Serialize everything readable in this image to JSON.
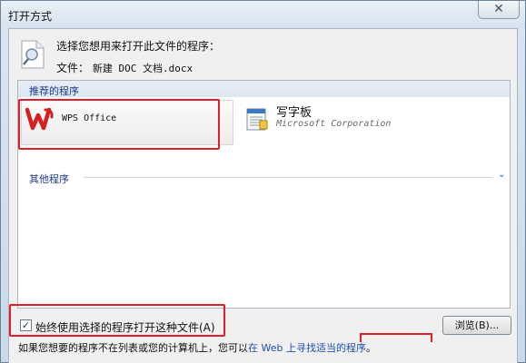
{
  "window": {
    "title": "打开方式",
    "close_glyph": "✕"
  },
  "header": {
    "prompt": "选择您想用来打开此文件的程序：",
    "file_label": "文件：",
    "file_name": "新建 DOC 文档.docx"
  },
  "list": {
    "recommended_label": "推荐的程序",
    "programs": [
      {
        "name": "WPS Office",
        "company": "",
        "icon": "wps-logo-icon"
      },
      {
        "name": "写字板",
        "company": "Microsoft Corporation",
        "icon": "wordpad-icon"
      }
    ],
    "other_label": "其他程序",
    "expand_glyph": "⌄"
  },
  "options": {
    "always_use_label": "始终使用选择的程序打开这种文件(A)",
    "always_use_checked": true,
    "check_glyph": "✓",
    "browse_label": "浏览(B)..."
  },
  "footer": {
    "hint_prefix": "如果您想要的程序不在列表或您的计算机上，您可以",
    "hint_link": "在 Web 上寻找适当的程序",
    "hint_suffix": "。"
  },
  "colors": {
    "highlight": "#e11d2a",
    "group_text": "#1e3a8a",
    "link": "#1f4fb6"
  }
}
